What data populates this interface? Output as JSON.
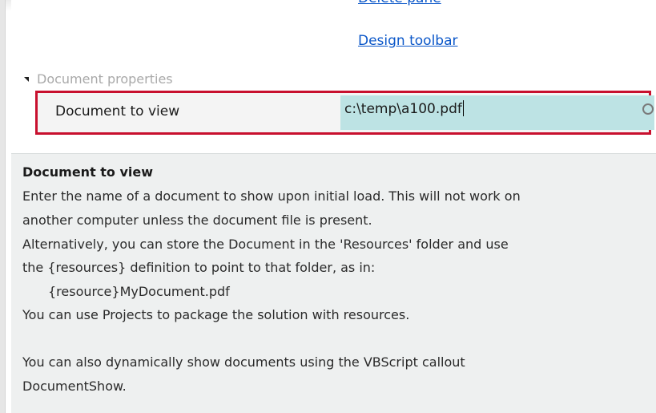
{
  "links": {
    "delete_pane": "Delete pane",
    "design_toolbar": "Design toolbar"
  },
  "group": {
    "label": "Document properties"
  },
  "property": {
    "name": "Document to view",
    "value": "c:\\temp\\a100.pdf"
  },
  "help": {
    "title": "Document to view",
    "lines": [
      "Enter the name of a document to show upon initial load. This will not work on",
      "another computer unless the document file is present.",
      "Alternatively, you can store the Document in the 'Resources' folder and use",
      "the {resources} definition to point to that folder, as in:",
      "{resource}MyDocument.pdf",
      "You can use Projects to package the solution with resources.",
      "You can also dynamically show documents using the VBScript callout",
      "DocumentShow."
    ]
  },
  "colors": {
    "highlight_border": "#c8102e",
    "value_background": "#bde3e4",
    "link": "#0b57c9",
    "help_background": "#eef0f0"
  },
  "icons": {
    "group_toggle": "triangle-expanded-icon",
    "browse": "circle-search-icon"
  }
}
